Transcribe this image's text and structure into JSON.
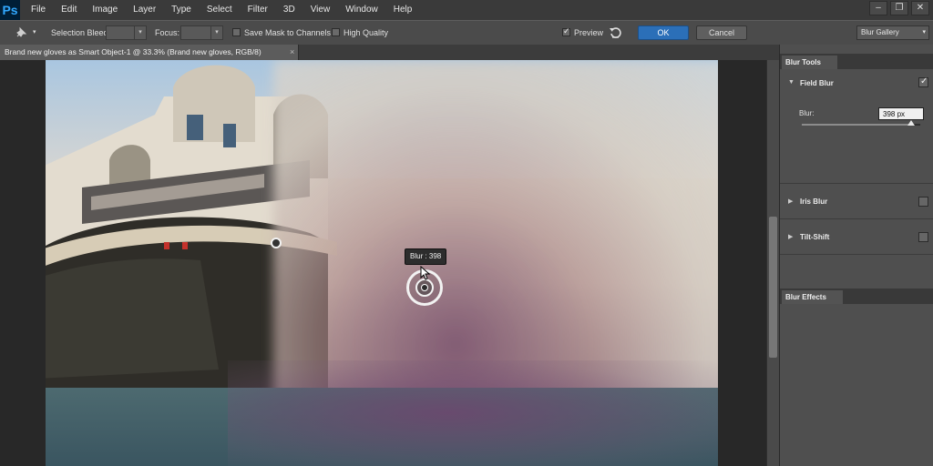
{
  "app": {
    "logo": "Ps"
  },
  "menu": [
    "File",
    "Edit",
    "Image",
    "Layer",
    "Type",
    "Select",
    "Filter",
    "3D",
    "View",
    "Window",
    "Help"
  ],
  "window_controls": {
    "minimize": "–",
    "restore": "❐",
    "close": "✕"
  },
  "options": {
    "selection_bleed_label": "Selection Bleed:",
    "focus_label": "Focus:",
    "save_mask_label": "Save Mask to Channels",
    "save_mask_checked": false,
    "high_quality_label": "High Quality",
    "high_quality_checked": false,
    "preview_label": "Preview",
    "preview_checked": true,
    "ok_label": "OK",
    "cancel_label": "Cancel",
    "workspace_select": "Blur Gallery"
  },
  "document": {
    "tab_title": "Brand new gloves as Smart Object-1 @ 33.3% (Brand new gloves, RGB/8)",
    "close": "×"
  },
  "canvas": {
    "tooltip": "Blur : 398"
  },
  "blur_tools": {
    "panel_title": "Blur Tools",
    "field_blur": {
      "label": "Field Blur",
      "checked": true,
      "expanded": true
    },
    "blur_label": "Blur:",
    "blur_value": "398 px",
    "blur_slider_fraction": 0.92,
    "iris_blur": {
      "label": "Iris Blur",
      "checked": false
    },
    "tilt_shift": {
      "label": "Tilt-Shift",
      "checked": false
    }
  },
  "blur_effects": {
    "panel_title": "Blur Effects"
  },
  "colors": {
    "accent": "#2b6fb8",
    "panel": "#4f4f4f",
    "menubar": "#3a3a3a"
  }
}
